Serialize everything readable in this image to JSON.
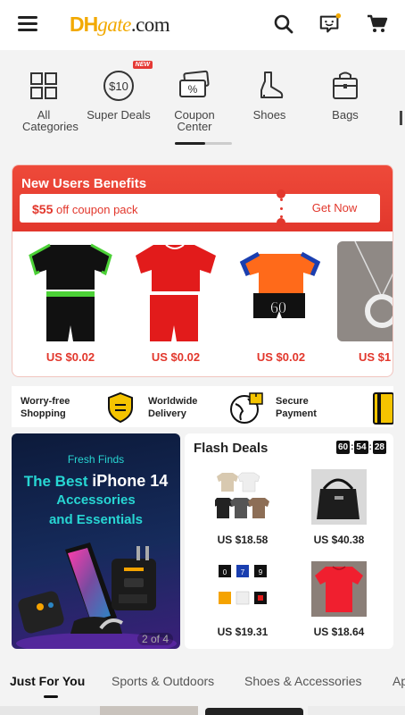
{
  "header": {
    "logo_dh": "DH",
    "logo_gate": "gate",
    "logo_com": ".com"
  },
  "categories": [
    {
      "label": "All Categories"
    },
    {
      "label": "Super Deals",
      "badge": "NEW",
      "icon_text": "$10"
    },
    {
      "label": "Coupon Center"
    },
    {
      "label": "Shoes"
    },
    {
      "label": "Bags"
    }
  ],
  "new_users": {
    "title": "New Users Benefits",
    "coupon_amount": "$55",
    "coupon_text": "off coupon pack",
    "cta": "Get Now",
    "products": [
      {
        "price": "US $0.02"
      },
      {
        "price": "US $0.02"
      },
      {
        "price": "US $0.02"
      },
      {
        "price": "US $1"
      }
    ]
  },
  "trust": [
    {
      "line1": "Worry-free",
      "line2": "Shopping"
    },
    {
      "line1": "Worldwide",
      "line2": "Delivery"
    },
    {
      "line1": "Secure",
      "line2": "Payment"
    }
  ],
  "banner": {
    "kicker": "Fresh Finds",
    "line1_pre": "The Best ",
    "line1_highlight": "iPhone 14",
    "line2": "Accessories",
    "line3": "and Essentials",
    "pager": "2 of 4"
  },
  "flash_deals": {
    "title": "Flash Deals",
    "timer": [
      "60",
      "54",
      "28"
    ],
    "items": [
      {
        "price": "US $18.58"
      },
      {
        "price": "US $40.38"
      },
      {
        "price": "US $19.31"
      },
      {
        "price": "US $18.64"
      }
    ]
  },
  "tabs": [
    "Just For You",
    "Sports & Outdoors",
    "Shoes & Accessories",
    "Ap"
  ],
  "colors": {
    "brand_red": "#e2372c",
    "logo_gold": "#f2a900",
    "banner_cyan": "#27d6d3"
  }
}
